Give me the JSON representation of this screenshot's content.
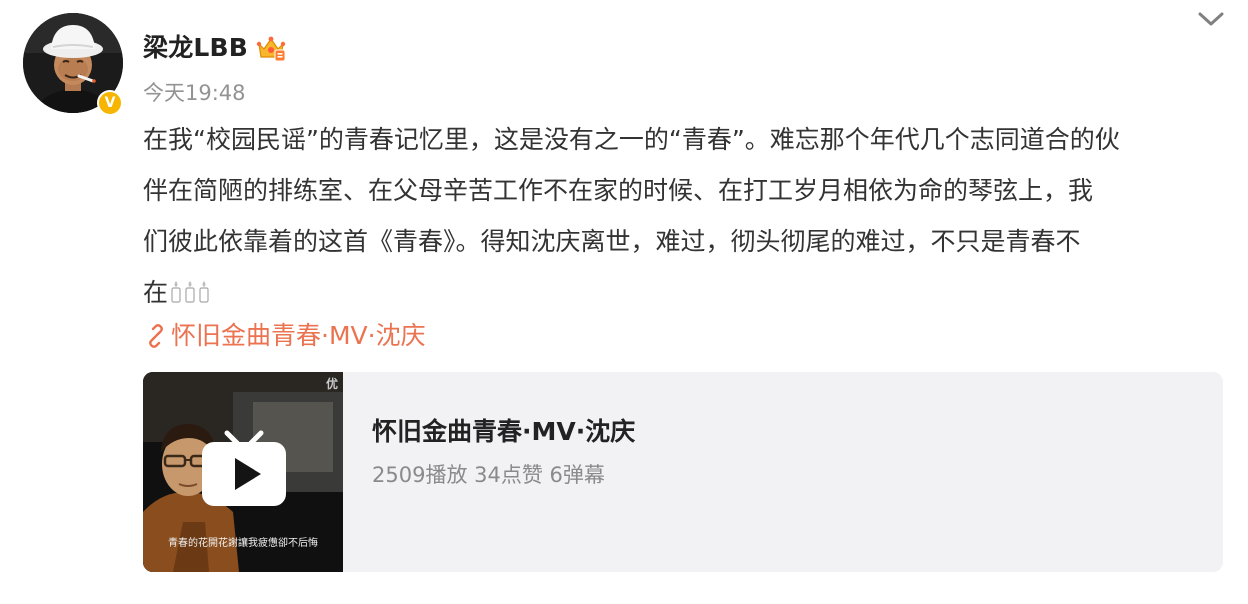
{
  "author": {
    "name": "梁龙LBB",
    "verified_badge": "V",
    "crown_icon": "crown-vip-icon"
  },
  "post": {
    "time": "今天19:48",
    "text_lines": [
      "在我“校园民谣”的青春记忆里，这是没有之一的“青春”。难忘那个年代几个志同道合的伙",
      "伴在简陋的排练室、在父母辛苦工作不在家的时候、在打工岁月相依为命的琴弦上，我",
      "们彼此依靠着的这首《青春》。得知沈庆离世，难过，彻头彻尾的难过，不只是青春不",
      "在"
    ],
    "trailing_emoji": "candle-icon x3",
    "link_text": "怀旧金曲青春·MV·沈庆"
  },
  "video": {
    "title": "怀旧金曲青春·MV·沈庆",
    "stats": "2509播放 34点赞 6弹幕",
    "thumb_corner_text": "优",
    "thumb_subtitle": "青春的花開花謝讓我疲憊卻不后悔"
  },
  "colors": {
    "link": "#eb7350",
    "badge": "#f7b500",
    "card_bg": "#f2f2f5",
    "time": "#939393"
  }
}
